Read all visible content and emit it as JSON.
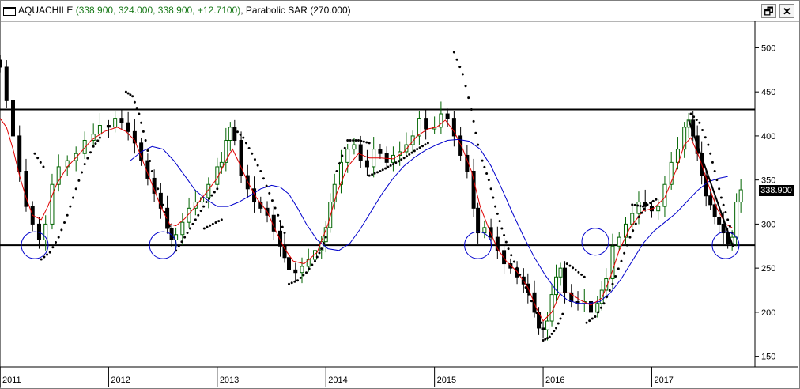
{
  "window": {
    "symbol": "AQUACHILE",
    "ohlc_text": "(338.900, 324.000, 338.900, +12.7100)",
    "indicator_text": "Parabolic SAR (270.000)",
    "restore_icon": "restore-window-icon",
    "close_icon": "close-icon",
    "restore_glyph": "🗗",
    "close_glyph": "✕"
  },
  "chart_data": {
    "type": "candlestick",
    "title": "AQUACHILE",
    "last_price_label": "338.900",
    "y_ticks": [
      500,
      450,
      400,
      350,
      300,
      250,
      200,
      150
    ],
    "y_tick_labels": [
      "500",
      "450",
      "400",
      "350",
      "300",
      "250",
      "200",
      "150"
    ],
    "x_year_labels": [
      "2011",
      "2012",
      "2013",
      "2014",
      "2015",
      "2016",
      "2017"
    ],
    "ylim": [
      138,
      530
    ],
    "xlim": [
      2011.0,
      2017.95
    ],
    "horizontal_lines": [
      430,
      276
    ],
    "trendline": [
      [
        2017.34,
        418
      ],
      [
        2017.75,
        274
      ]
    ],
    "colors": {
      "candle": "#006400",
      "candle_down": "#000000",
      "sma_fast": "#e00000",
      "sma_slow": "#0000cc",
      "sar": "#000000",
      "circle": "#0000cc",
      "hline": "#000000"
    },
    "close_series": [
      [
        2011.0,
        478
      ],
      [
        2011.06,
        440
      ],
      [
        2011.12,
        400
      ],
      [
        2011.18,
        360
      ],
      [
        2011.24,
        320
      ],
      [
        2011.3,
        300
      ],
      [
        2011.36,
        282
      ],
      [
        2011.42,
        300
      ],
      [
        2011.48,
        345
      ],
      [
        2011.54,
        365
      ],
      [
        2011.62,
        372
      ],
      [
        2011.7,
        380
      ],
      [
        2011.78,
        395
      ],
      [
        2011.86,
        402
      ],
      [
        2011.92,
        412
      ],
      [
        2012.0,
        410
      ],
      [
        2012.06,
        420
      ],
      [
        2012.12,
        415
      ],
      [
        2012.18,
        405
      ],
      [
        2012.24,
        392
      ],
      [
        2012.3,
        372
      ],
      [
        2012.36,
        352
      ],
      [
        2012.42,
        335
      ],
      [
        2012.48,
        318
      ],
      [
        2012.54,
        295
      ],
      [
        2012.58,
        282
      ],
      [
        2012.62,
        288
      ],
      [
        2012.68,
        302
      ],
      [
        2012.74,
        318
      ],
      [
        2012.8,
        325
      ],
      [
        2012.86,
        330
      ],
      [
        2012.92,
        345
      ],
      [
        2013.0,
        365
      ],
      [
        2013.04,
        370
      ],
      [
        2013.08,
        395
      ],
      [
        2013.12,
        410
      ],
      [
        2013.16,
        395
      ],
      [
        2013.22,
        355
      ],
      [
        2013.28,
        340
      ],
      [
        2013.34,
        325
      ],
      [
        2013.4,
        318
      ],
      [
        2013.46,
        310
      ],
      [
        2013.52,
        292
      ],
      [
        2013.58,
        275
      ],
      [
        2013.62,
        262
      ],
      [
        2013.66,
        248
      ],
      [
        2013.72,
        245
      ],
      [
        2013.78,
        252
      ],
      [
        2013.84,
        260
      ],
      [
        2013.9,
        270
      ],
      [
        2013.96,
        280
      ],
      [
        2014.0,
        296
      ],
      [
        2014.04,
        325
      ],
      [
        2014.08,
        345
      ],
      [
        2014.14,
        370
      ],
      [
        2014.2,
        385
      ],
      [
        2014.26,
        390
      ],
      [
        2014.32,
        372
      ],
      [
        2014.38,
        365
      ],
      [
        2014.44,
        385
      ],
      [
        2014.5,
        380
      ],
      [
        2014.56,
        370
      ],
      [
        2014.62,
        378
      ],
      [
        2014.68,
        382
      ],
      [
        2014.74,
        390
      ],
      [
        2014.8,
        400
      ],
      [
        2014.86,
        420
      ],
      [
        2014.92,
        408
      ],
      [
        2015.0,
        410
      ],
      [
        2015.06,
        425
      ],
      [
        2015.12,
        420
      ],
      [
        2015.18,
        400
      ],
      [
        2015.24,
        378
      ],
      [
        2015.3,
        360
      ],
      [
        2015.36,
        318
      ],
      [
        2015.4,
        290
      ],
      [
        2015.46,
        296
      ],
      [
        2015.52,
        285
      ],
      [
        2015.58,
        270
      ],
      [
        2015.64,
        255
      ],
      [
        2015.7,
        250
      ],
      [
        2015.76,
        240
      ],
      [
        2015.82,
        232
      ],
      [
        2015.86,
        222
      ],
      [
        2015.92,
        200
      ],
      [
        2015.96,
        182
      ],
      [
        2016.0,
        180
      ],
      [
        2016.04,
        190
      ],
      [
        2016.08,
        220
      ],
      [
        2016.12,
        240
      ],
      [
        2016.16,
        250
      ],
      [
        2016.2,
        222
      ],
      [
        2016.26,
        212
      ],
      [
        2016.32,
        210
      ],
      [
        2016.38,
        212
      ],
      [
        2016.44,
        200
      ],
      [
        2016.5,
        210
      ],
      [
        2016.54,
        225
      ],
      [
        2016.58,
        238
      ],
      [
        2016.64,
        275
      ],
      [
        2016.7,
        285
      ],
      [
        2016.76,
        300
      ],
      [
        2016.82,
        312
      ],
      [
        2016.88,
        325
      ],
      [
        2016.94,
        320
      ],
      [
        2017.0,
        315
      ],
      [
        2017.06,
        320
      ],
      [
        2017.12,
        345
      ],
      [
        2017.18,
        370
      ],
      [
        2017.24,
        385
      ],
      [
        2017.3,
        410
      ],
      [
        2017.34,
        418
      ],
      [
        2017.38,
        400
      ],
      [
        2017.42,
        380
      ],
      [
        2017.46,
        355
      ],
      [
        2017.5,
        332
      ],
      [
        2017.54,
        322
      ],
      [
        2017.58,
        308
      ],
      [
        2017.62,
        300
      ],
      [
        2017.66,
        290
      ],
      [
        2017.7,
        278
      ],
      [
        2017.74,
        285
      ],
      [
        2017.78,
        325
      ],
      [
        2017.82,
        338.9
      ]
    ],
    "sma_fast_series": [
      [
        2011.0,
        420
      ],
      [
        2011.06,
        410
      ],
      [
        2011.12,
        385
      ],
      [
        2011.18,
        355
      ],
      [
        2011.24,
        330
      ],
      [
        2011.3,
        310
      ],
      [
        2011.38,
        305
      ],
      [
        2011.44,
        320
      ],
      [
        2011.52,
        345
      ],
      [
        2011.62,
        365
      ],
      [
        2011.72,
        378
      ],
      [
        2011.84,
        395
      ],
      [
        2011.96,
        405
      ],
      [
        2012.08,
        410
      ],
      [
        2012.16,
        405
      ],
      [
        2012.24,
        395
      ],
      [
        2012.32,
        370
      ],
      [
        2012.4,
        345
      ],
      [
        2012.48,
        320
      ],
      [
        2012.56,
        300
      ],
      [
        2012.62,
        298
      ],
      [
        2012.7,
        306
      ],
      [
        2012.8,
        320
      ],
      [
        2012.9,
        336
      ],
      [
        2013.0,
        352
      ],
      [
        2013.08,
        372
      ],
      [
        2013.14,
        385
      ],
      [
        2013.2,
        370
      ],
      [
        2013.28,
        348
      ],
      [
        2013.36,
        330
      ],
      [
        2013.46,
        314
      ],
      [
        2013.54,
        292
      ],
      [
        2013.62,
        272
      ],
      [
        2013.7,
        258
      ],
      [
        2013.8,
        255
      ],
      [
        2013.92,
        268
      ],
      [
        2014.02,
        300
      ],
      [
        2014.1,
        335
      ],
      [
        2014.2,
        365
      ],
      [
        2014.3,
        380
      ],
      [
        2014.4,
        375
      ],
      [
        2014.5,
        375
      ],
      [
        2014.62,
        374
      ],
      [
        2014.72,
        382
      ],
      [
        2014.84,
        400
      ],
      [
        2014.94,
        408
      ],
      [
        2015.02,
        410
      ],
      [
        2015.1,
        418
      ],
      [
        2015.18,
        405
      ],
      [
        2015.26,
        385
      ],
      [
        2015.34,
        360
      ],
      [
        2015.42,
        320
      ],
      [
        2015.5,
        295
      ],
      [
        2015.58,
        272
      ],
      [
        2015.66,
        258
      ],
      [
        2015.76,
        246
      ],
      [
        2015.86,
        228
      ],
      [
        2015.94,
        204
      ],
      [
        2016.0,
        190
      ],
      [
        2016.08,
        200
      ],
      [
        2016.16,
        222
      ],
      [
        2016.24,
        222
      ],
      [
        2016.34,
        214
      ],
      [
        2016.44,
        208
      ],
      [
        2016.54,
        216
      ],
      [
        2016.62,
        240
      ],
      [
        2016.7,
        270
      ],
      [
        2016.8,
        296
      ],
      [
        2016.92,
        315
      ],
      [
        2017.02,
        318
      ],
      [
        2017.12,
        330
      ],
      [
        2017.22,
        360
      ],
      [
        2017.3,
        390
      ],
      [
        2017.36,
        398
      ],
      [
        2017.44,
        375
      ],
      [
        2017.52,
        345
      ],
      [
        2017.6,
        318
      ],
      [
        2017.68,
        300
      ],
      [
        2017.74,
        296
      ]
    ],
    "sma_slow_series": [
      [
        2012.2,
        372
      ],
      [
        2012.3,
        382
      ],
      [
        2012.4,
        388
      ],
      [
        2012.5,
        385
      ],
      [
        2012.6,
        372
      ],
      [
        2012.7,
        355
      ],
      [
        2012.8,
        338
      ],
      [
        2012.9,
        328
      ],
      [
        2013.0,
        320
      ],
      [
        2013.1,
        320
      ],
      [
        2013.2,
        325
      ],
      [
        2013.3,
        332
      ],
      [
        2013.4,
        340
      ],
      [
        2013.5,
        344
      ],
      [
        2013.58,
        342
      ],
      [
        2013.66,
        334
      ],
      [
        2013.74,
        318
      ],
      [
        2013.82,
        300
      ],
      [
        2013.92,
        282
      ],
      [
        2014.02,
        272
      ],
      [
        2014.12,
        270
      ],
      [
        2014.22,
        278
      ],
      [
        2014.32,
        295
      ],
      [
        2014.42,
        315
      ],
      [
        2014.52,
        335
      ],
      [
        2014.62,
        352
      ],
      [
        2014.72,
        366
      ],
      [
        2014.82,
        376
      ],
      [
        2014.92,
        384
      ],
      [
        2015.02,
        390
      ],
      [
        2015.12,
        395
      ],
      [
        2015.22,
        396
      ],
      [
        2015.32,
        394
      ],
      [
        2015.42,
        385
      ],
      [
        2015.52,
        366
      ],
      [
        2015.62,
        340
      ],
      [
        2015.72,
        312
      ],
      [
        2015.82,
        286
      ],
      [
        2015.92,
        262
      ],
      [
        2016.02,
        242
      ],
      [
        2016.12,
        225
      ],
      [
        2016.22,
        214
      ],
      [
        2016.32,
        210
      ],
      [
        2016.42,
        210
      ],
      [
        2016.52,
        212
      ],
      [
        2016.62,
        222
      ],
      [
        2016.72,
        238
      ],
      [
        2016.82,
        258
      ],
      [
        2016.92,
        278
      ],
      [
        2017.02,
        292
      ],
      [
        2017.12,
        302
      ],
      [
        2017.22,
        312
      ],
      [
        2017.32,
        325
      ],
      [
        2017.42,
        338
      ],
      [
        2017.52,
        348
      ],
      [
        2017.62,
        352
      ],
      [
        2017.7,
        354
      ]
    ],
    "sar_segments": [
      [
        [
          2011.32,
          380
        ],
        [
          2011.4,
          365
        ]
      ],
      [
        [
          2011.38,
          260
        ],
        [
          2011.46,
          268
        ],
        [
          2011.54,
          285
        ],
        [
          2011.62,
          310
        ],
        [
          2011.7,
          340
        ],
        [
          2011.78,
          368
        ],
        [
          2011.86,
          388
        ],
        [
          2011.92,
          398
        ]
      ],
      [
        [
          2012.16,
          450
        ],
        [
          2012.22,
          445
        ],
        [
          2012.28,
          425
        ],
        [
          2012.34,
          395
        ],
        [
          2012.4,
          360
        ],
        [
          2012.48,
          330
        ],
        [
          2012.54,
          305
        ],
        [
          2012.58,
          290
        ]
      ],
      [
        [
          2012.62,
          270
        ],
        [
          2012.7,
          285
        ],
        [
          2012.8,
          305
        ],
        [
          2012.9,
          325
        ],
        [
          2013.0,
          340
        ]
      ],
      [
        [
          2012.88,
          295
        ],
        [
          2012.96,
          300
        ],
        [
          2013.04,
          305
        ]
      ],
      [
        [
          2013.16,
          408
        ],
        [
          2013.24,
          398
        ],
        [
          2013.32,
          380
        ],
        [
          2013.4,
          360
        ],
        [
          2013.48,
          335
        ],
        [
          2013.56,
          310
        ],
        [
          2013.62,
          290
        ]
      ],
      [
        [
          2013.66,
          232
        ],
        [
          2013.74,
          236
        ],
        [
          2013.82,
          245
        ],
        [
          2013.9,
          258
        ],
        [
          2013.96,
          272
        ],
        [
          2014.0,
          285
        ]
      ],
      [
        [
          2014.1,
          360
        ],
        [
          2014.2,
          395
        ],
        [
          2014.3,
          395
        ],
        [
          2014.4,
          392
        ]
      ],
      [
        [
          2014.4,
          355
        ],
        [
          2014.5,
          360
        ],
        [
          2014.62,
          368
        ],
        [
          2014.72,
          375
        ],
        [
          2014.84,
          385
        ],
        [
          2014.94,
          392
        ]
      ],
      [
        [
          2015.18,
          495
        ],
        [
          2015.26,
          470
        ],
        [
          2015.34,
          430
        ],
        [
          2015.4,
          390
        ]
      ],
      [
        [
          2015.44,
          372
        ],
        [
          2015.5,
          350
        ],
        [
          2015.56,
          320
        ],
        [
          2015.62,
          295
        ],
        [
          2015.68,
          272
        ],
        [
          2015.76,
          250
        ],
        [
          2015.84,
          228
        ],
        [
          2015.92,
          205
        ],
        [
          2015.98,
          188
        ]
      ],
      [
        [
          2016.0,
          168
        ],
        [
          2016.06,
          172
        ],
        [
          2016.12,
          182
        ],
        [
          2016.18,
          198
        ]
      ],
      [
        [
          2016.22,
          255
        ],
        [
          2016.3,
          248
        ],
        [
          2016.38,
          240
        ]
      ],
      [
        [
          2016.4,
          188
        ],
        [
          2016.48,
          195
        ],
        [
          2016.56,
          210
        ],
        [
          2016.64,
          232
        ],
        [
          2016.72,
          258
        ],
        [
          2016.8,
          285
        ],
        [
          2016.88,
          308
        ],
        [
          2016.96,
          322
        ],
        [
          2017.04,
          328
        ]
      ],
      [
        [
          2016.82,
          322
        ],
        [
          2016.92,
          320
        ]
      ],
      [
        [
          2017.36,
          425
        ],
        [
          2017.44,
          415
        ],
        [
          2017.52,
          390
        ],
        [
          2017.58,
          360
        ],
        [
          2017.64,
          330
        ],
        [
          2017.7,
          305
        ],
        [
          2017.74,
          290
        ]
      ]
    ],
    "circles": [
      [
        2011.32,
        276
      ],
      [
        2012.5,
        276
      ],
      [
        2015.4,
        276
      ],
      [
        2016.48,
        280
      ],
      [
        2017.68,
        276
      ]
    ]
  }
}
